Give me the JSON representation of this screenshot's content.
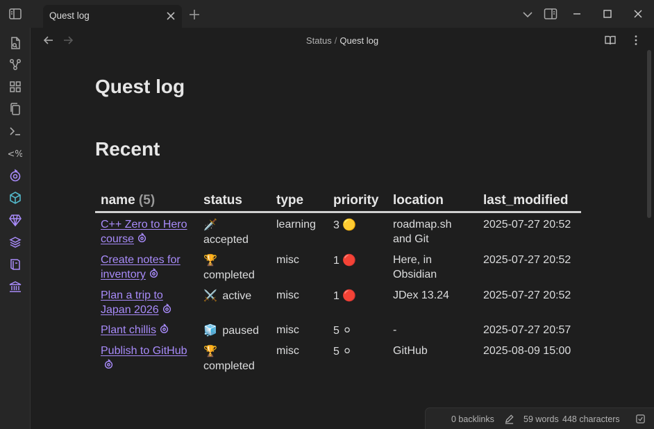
{
  "tab": {
    "title": "Quest log"
  },
  "breadcrumb": {
    "parent": "Status",
    "separator": "/",
    "current": "Quest log"
  },
  "headings": {
    "title": "Quest log",
    "section": "Recent"
  },
  "table": {
    "columns": {
      "name": "name",
      "name_count": "(5)",
      "status": "status",
      "type": "type",
      "priority": "priority",
      "location": "location",
      "last_modified": "last_modified"
    },
    "rows": [
      {
        "name": "C++ Zero to Hero course",
        "status_emoji": "🗡️",
        "status": "accepted",
        "type": "learning",
        "priority": "3",
        "priority_emoji": "🟡",
        "location": "roadmap.sh and Git",
        "last_modified": "2025-07-27 20:52"
      },
      {
        "name": "Create notes for inventory",
        "status_emoji": "🏆",
        "status": "completed",
        "type": "misc",
        "priority": "1",
        "priority_emoji": "🔴",
        "location": "Here, in Obsidian",
        "last_modified": "2025-07-27 20:52"
      },
      {
        "name": "Plan a trip to Japan 2026",
        "status_emoji": "⚔️",
        "status": "active",
        "type": "misc",
        "priority": "1",
        "priority_emoji": "🔴",
        "location": "JDex 13.24",
        "last_modified": "2025-07-27 20:52"
      },
      {
        "name": "Plant chillis",
        "status_emoji": "🧊",
        "status": "paused",
        "type": "misc",
        "priority": "5",
        "priority_emoji": "⚪",
        "location": "-",
        "last_modified": "2025-07-27 20:57"
      },
      {
        "name": "Publish to GitHub",
        "status_emoji": "🏆",
        "status": "completed",
        "type": "misc",
        "priority": "5",
        "priority_emoji": "⚪",
        "location": "GitHub",
        "last_modified": "2025-08-09 15:00"
      }
    ]
  },
  "statusbar": {
    "backlinks": "0 backlinks",
    "words": "59 words",
    "characters": "448 characters"
  },
  "colors": {
    "accent": "#a88bfa",
    "teal": "#53b7c9",
    "background": "#1e1e1e",
    "chrome": "#262626"
  },
  "icons": {
    "ribbon": [
      "file-open-icon",
      "graph-icon",
      "grid-icon",
      "copy-icon",
      "terminal-icon",
      "template-icon",
      "goal-icon",
      "cube-icon",
      "gem-icon",
      "layers-icon",
      "book-icon",
      "bank-icon"
    ]
  }
}
